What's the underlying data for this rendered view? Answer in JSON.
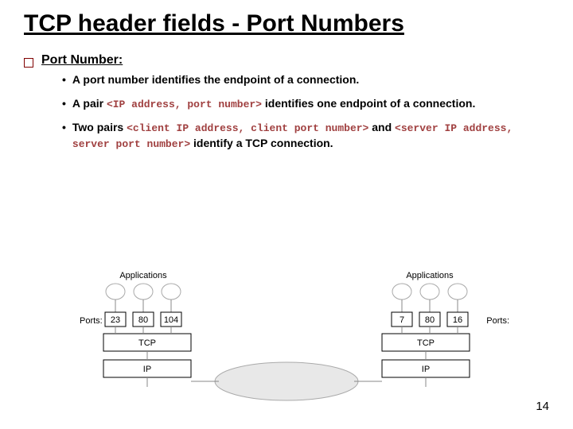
{
  "title": "TCP header fields - Port Numbers",
  "heading": "Port Number:",
  "bullets": {
    "b1": "A port number identifies the endpoint of a connection.",
    "b2_a": "A pair ",
    "b2_code": "<IP address, port number>",
    "b2_b": " identifies one endpoint of a connection.",
    "b3_a": "Two pairs ",
    "b3_code1": "<client IP address, client port number>",
    "b3_mid": " and ",
    "b3_code2": "<server IP address, server port number>",
    "b3_b": " identify a TCP connection."
  },
  "diagram": {
    "apps": "Applications",
    "ports_label": "Ports:",
    "left_ports": [
      "23",
      "80",
      "104"
    ],
    "right_ports": [
      "7",
      "80",
      "16"
    ],
    "tcp": "TCP",
    "ip": "IP"
  },
  "page": "14"
}
